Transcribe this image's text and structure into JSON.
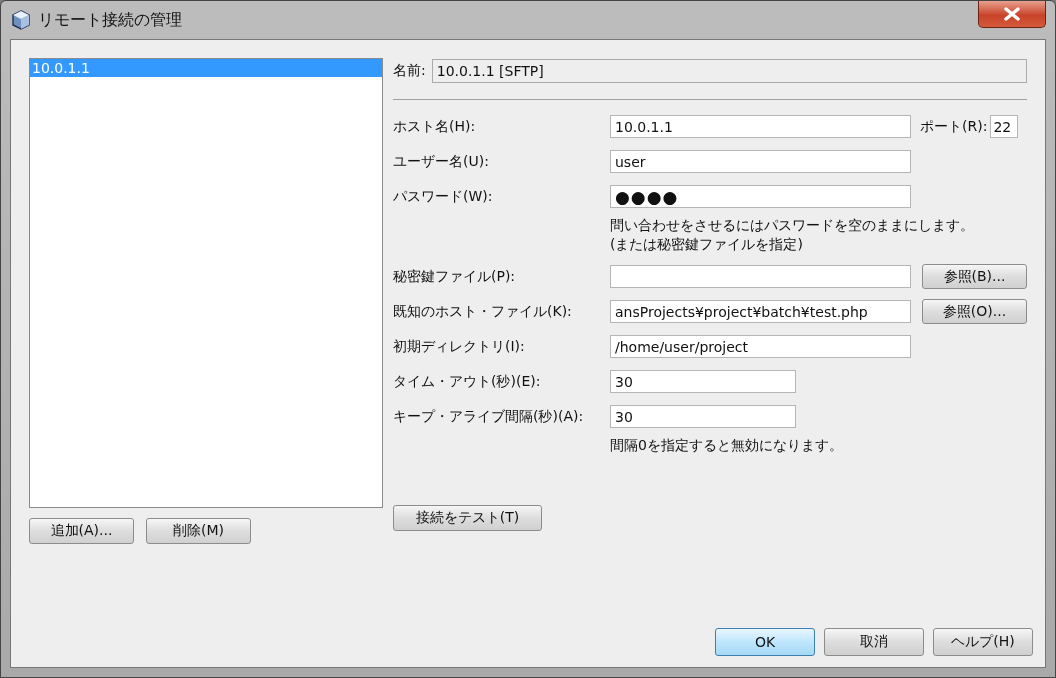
{
  "window": {
    "title": "リモート接続の管理"
  },
  "connections": [
    {
      "label": "10.0.1.1",
      "selected": true
    }
  ],
  "list_buttons": [
    "追加(A)...",
    "削除(M)"
  ],
  "name": {
    "label": "名前:",
    "value": "10.0.1.1 [SFTP]"
  },
  "rows": [
    {
      "kind": "field",
      "label": "ホスト名(H):",
      "value": "10.0.1.1",
      "port": {
        "label": "ポート(R):",
        "value": "22"
      }
    },
    {
      "kind": "field",
      "label": "ユーザー名(U):",
      "value": "user"
    },
    {
      "kind": "password",
      "label": "パスワード(W):",
      "value": "●●●●"
    },
    {
      "kind": "note",
      "lines": [
        "問い合わせをさせるにはパスワードを空のままにします。",
        "(または秘密鍵ファイルを指定)"
      ]
    },
    {
      "kind": "field",
      "label": "秘密鍵ファイル(P):",
      "value": "",
      "button": "参照(B)..."
    },
    {
      "kind": "field",
      "label": "既知のホスト・ファイル(K):",
      "value": "ansProjects¥project¥batch¥test.php",
      "button": "参照(O)..."
    },
    {
      "kind": "field",
      "label": "初期ディレクトリ(I):",
      "value": "/home/user/project"
    },
    {
      "kind": "number",
      "label": "タイム・アウト(秒)(E):",
      "value": "30"
    },
    {
      "kind": "number",
      "label": "キープ・アライブ間隔(秒)(A):",
      "value": "30"
    },
    {
      "kind": "note",
      "lines": [
        "間隔0を指定すると無効になります。"
      ]
    }
  ],
  "test_button": "接続をテスト(T)",
  "dialog_buttons": [
    {
      "label": "OK",
      "default": true
    },
    {
      "label": "取消",
      "default": false
    },
    {
      "label": "ヘルプ(H)",
      "default": false
    }
  ]
}
